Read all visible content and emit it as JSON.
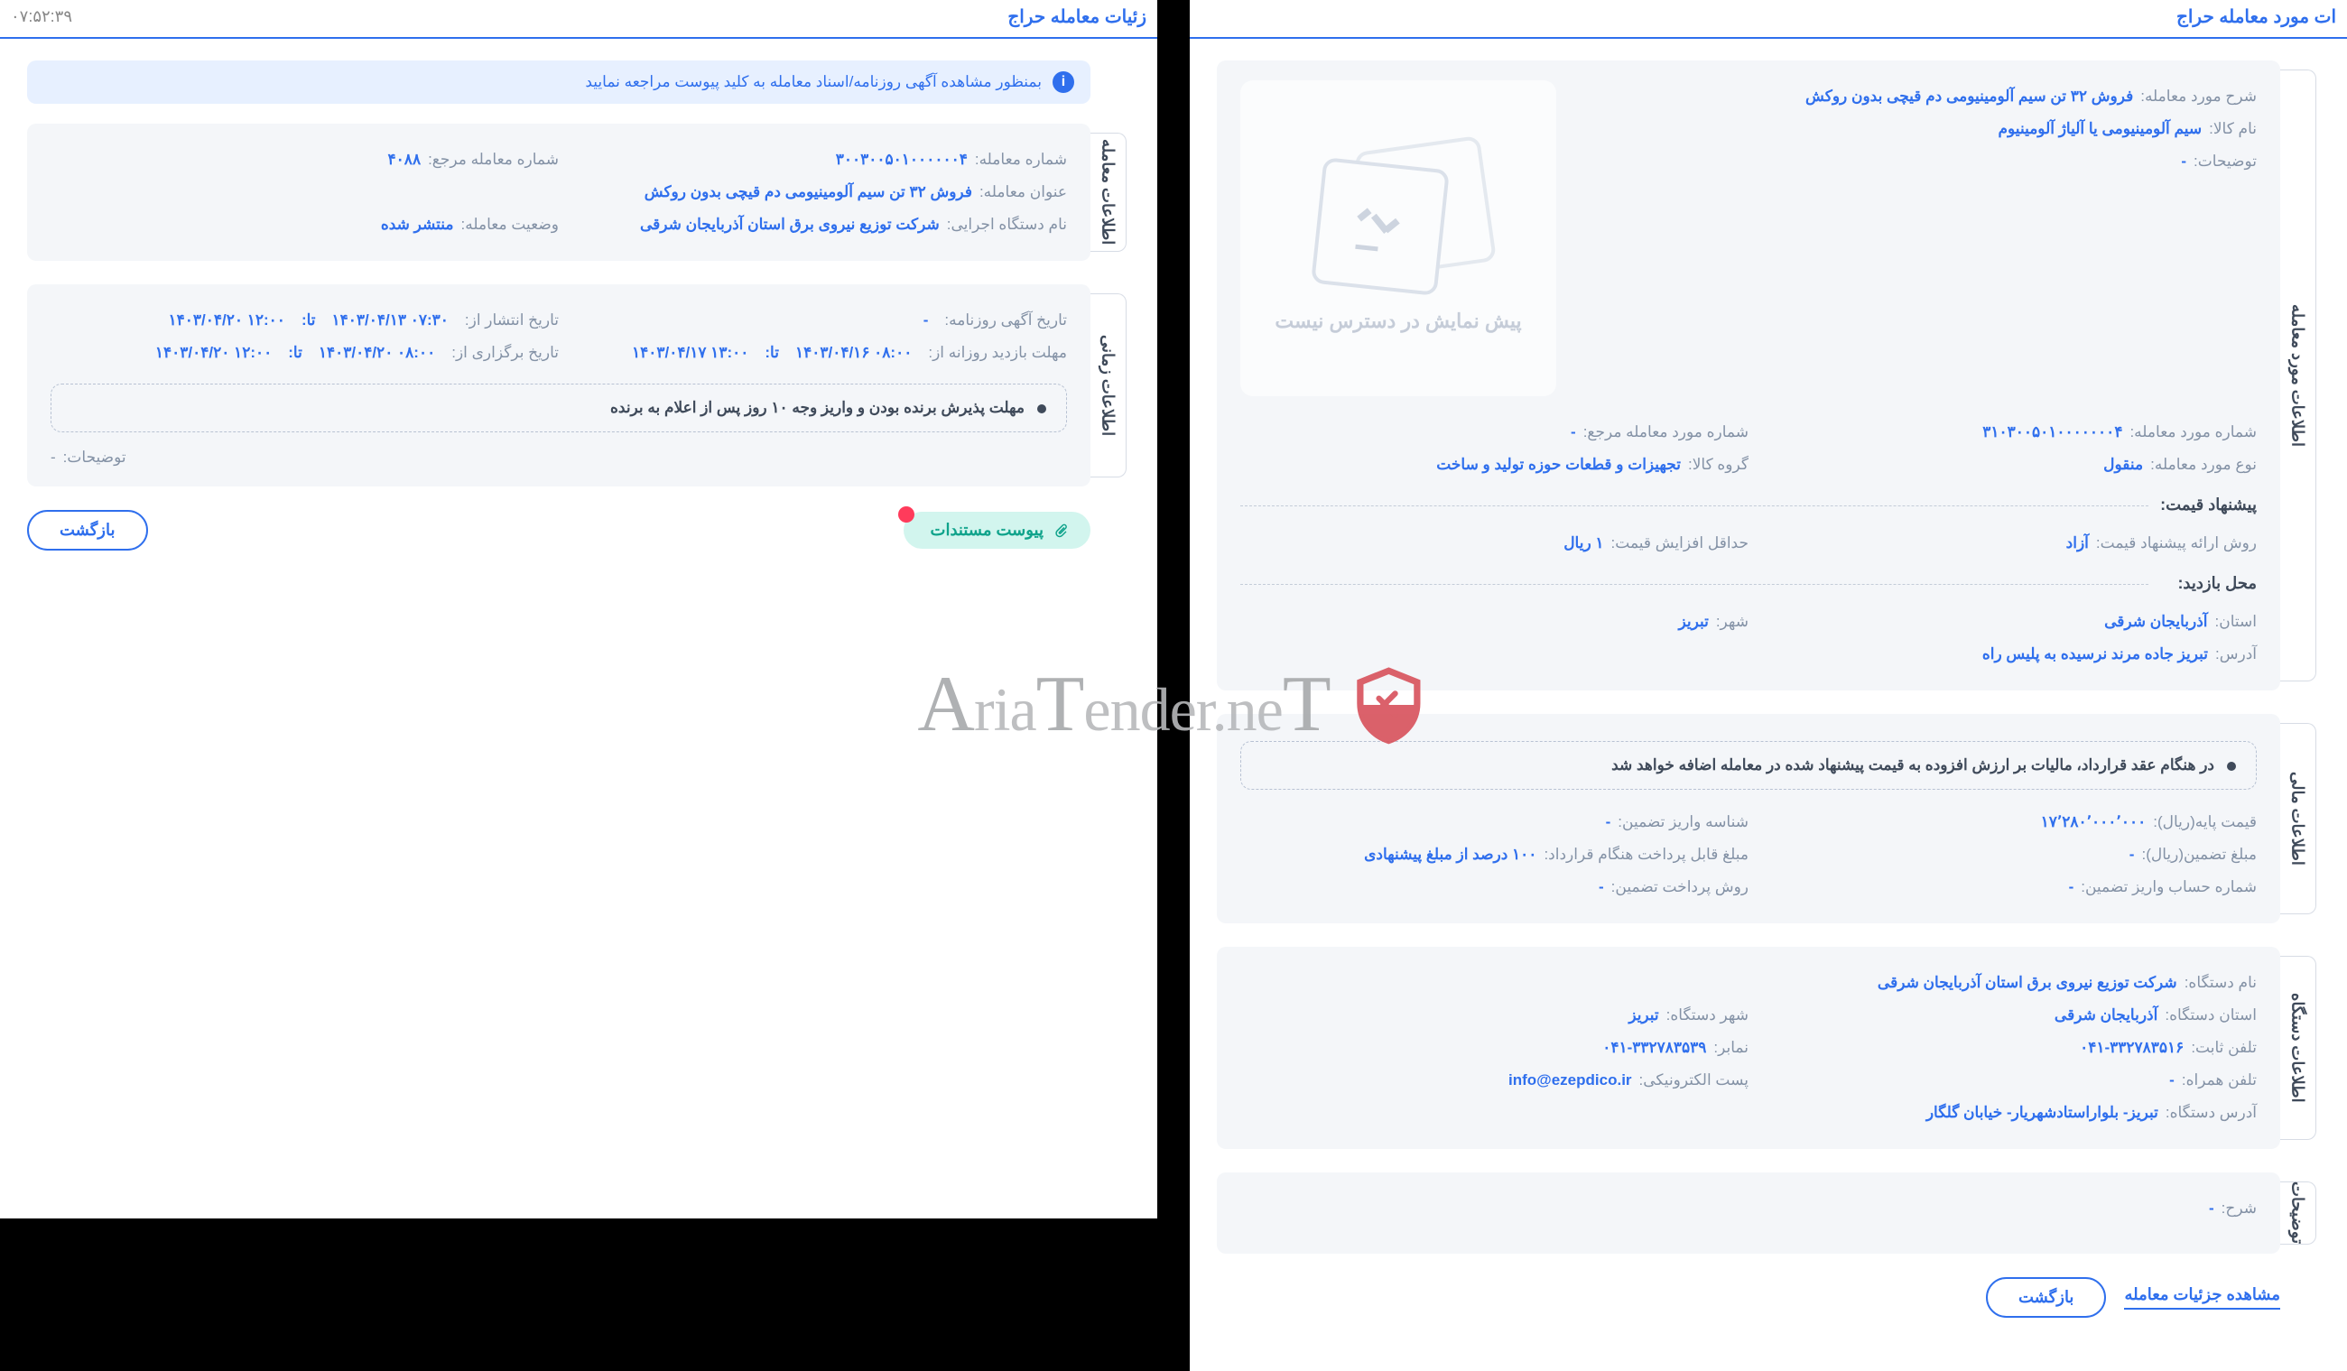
{
  "header_right": {
    "title": "ات مورد معامله حراج"
  },
  "header_left": {
    "title": "زئیات معامله حراج",
    "time": "۰۷:۵۲:۳۹"
  },
  "right": {
    "image_placeholder": "پیش نمایش در دسترس نیست",
    "item_info": {
      "desc_label": "شرح مورد معامله:",
      "desc_value": "فروش ۳۲ تن سیم آلومینیومی دم قیچی بدون روکش",
      "name_label": "نام کالا:",
      "name_value": "سیم آلومینیومی یا آلیاژ آلومینیوم",
      "notes_label": "توضیحات:",
      "notes_value": "-"
    },
    "group1": {
      "item_no_label": "شماره مورد معامله:",
      "item_no_value": "۳۱۰۳۰۰۵۰۱۰۰۰۰۰۰۰۴",
      "ref_no_label": "شماره مورد معامله مرجع:",
      "ref_no_value": "-",
      "type_label": "نوع مورد معامله:",
      "type_value": "منقول",
      "group_label": "گروه کالا:",
      "group_value": "تجهیزات و قطعات حوزه تولید و ساخت"
    },
    "price_head": "پیشنهاد قیمت:",
    "price": {
      "method_label": "روش ارائه پیشنهاد قیمت:",
      "method_value": "آزاد",
      "step_label": "حداقل افزایش قیمت:",
      "step_value": "۱ ریال"
    },
    "visit_head": "محل بازدید:",
    "visit": {
      "province_label": "استان:",
      "province_value": "آذربایجان شرقی",
      "city_label": "شهر:",
      "city_value": "تبریز",
      "address_label": "آدرس:",
      "address_value": "تبریز جاده مرند نرسیده به پلیس راه"
    },
    "fin_tab": "اطلاعات مالی",
    "fin_note": "در هنگام عقد قرارداد، مالیات بر ارزش افزوده به قیمت پیشنهاد شده در معامله اضافه خواهد شد",
    "fin": {
      "base_label": "قیمت پایه(ریال):",
      "base_value": "۱۷٬۲۸۰٬۰۰۰٬۰۰۰",
      "dep_id_label": "شناسه واریز تضمین:",
      "dep_id_value": "-",
      "dep_label": "مبلغ تضمین(ریال):",
      "dep_value": "-",
      "pay_label": "مبلغ قابل پرداخت هنگام قرارداد:",
      "pay_value": "۱۰۰ درصد از مبلغ پیشنهادی",
      "acct_label": "شماره حساب واریز تضمین:",
      "acct_value": "-",
      "method_label": "روش پرداخت تضمین:",
      "method_value": "-"
    },
    "org_tab": "اطلاعات دستگاه",
    "org": {
      "name_label": "نام دستگاه:",
      "name_value": "شرکت توزیع نیروی برق استان آذربایجان شرقی",
      "province_label": "استان دستگاه:",
      "province_value": "آذربایجان شرقی",
      "city_label": "شهر دستگاه:",
      "city_value": "تبریز",
      "phone_label": "تلفن ثابت:",
      "phone_value": "۰۴۱-۳۳۲۷۸۳۵۱۶",
      "fax_label": "نمابر:",
      "fax_value": "۰۴۱-۳۳۲۷۸۳۵۳۹",
      "mobile_label": "تلفن همراه:",
      "mobile_value": "-",
      "email_label": "پست الکترونیکی:",
      "email_value": "info@ezepdico.ir",
      "address_label": "آدرس دستگاه:",
      "address_value": "تبریز- بلواراستادشهریار- خیابان گلگار"
    },
    "remarks_tab": "توضیحات",
    "remarks": {
      "label": "شرح:",
      "value": "-"
    },
    "more_btn": "مشاهده جزئیات معامله",
    "back_btn": "بازگشت"
  },
  "left": {
    "alert": "بمنظور مشاهده آگهی روزنامه/اسناد معامله به کلید پیوست مراجعه نمایید",
    "deal_tab": "اطلاعات معامله",
    "deal": {
      "no_label": "شماره معامله:",
      "no_value": "۳۰۰۳۰۰۵۰۱۰۰۰۰۰۰۴",
      "ref_label": "شماره معامله مرجع:",
      "ref_value": "۴۰۸۸",
      "title_label": "عنوان معامله:",
      "title_value": "فروش ۳۲ تن سیم آلومینیومی دم قیچی بدون روکش",
      "org_label": "نام دستگاه اجرایی:",
      "org_value": "شرکت توزیع نیروی برق استان آذربایجان شرقی",
      "status_label": "وضعیت معامله:",
      "status_value": "منتشر شده"
    },
    "time_tab": "اطلاعات زمانی",
    "time": {
      "news_label": "تاریخ آگهی روزنامه:",
      "news_value": "-",
      "pub_label": "تاریخ انتشار از:",
      "pub_from": "۱۴۰۳/۰۴/۱۳ ۰۷:۳۰",
      "pub_to": "۱۴۰۳/۰۴/۲۰ ۱۲:۰۰",
      "sep": "تا:",
      "visit_label": "مهلت بازدید روزانه از:",
      "visit_from": "۱۴۰۳/۰۴/۱۶ ۰۸:۰۰",
      "visit_to": "۱۴۰۳/۰۴/۱۷ ۱۳:۰۰",
      "hold_label": "تاریخ برگزاری از:",
      "hold_from": "۱۴۰۳/۰۴/۲۰ ۰۸:۰۰",
      "hold_to": "۱۴۰۳/۰۴/۲۰ ۱۲:۰۰",
      "pay_note": "مهلت پذیرش برنده بودن و واریز وجه ۱۰ روز پس از اعلام به برنده",
      "notes_label": "توضیحات:",
      "notes_value": "-"
    },
    "attach_btn": "پیوست مستندات",
    "back_btn": "بازگشت"
  },
  "tabs": {
    "item": "اطلاعات مورد معامله"
  },
  "watermark": "AriaTender.neT"
}
